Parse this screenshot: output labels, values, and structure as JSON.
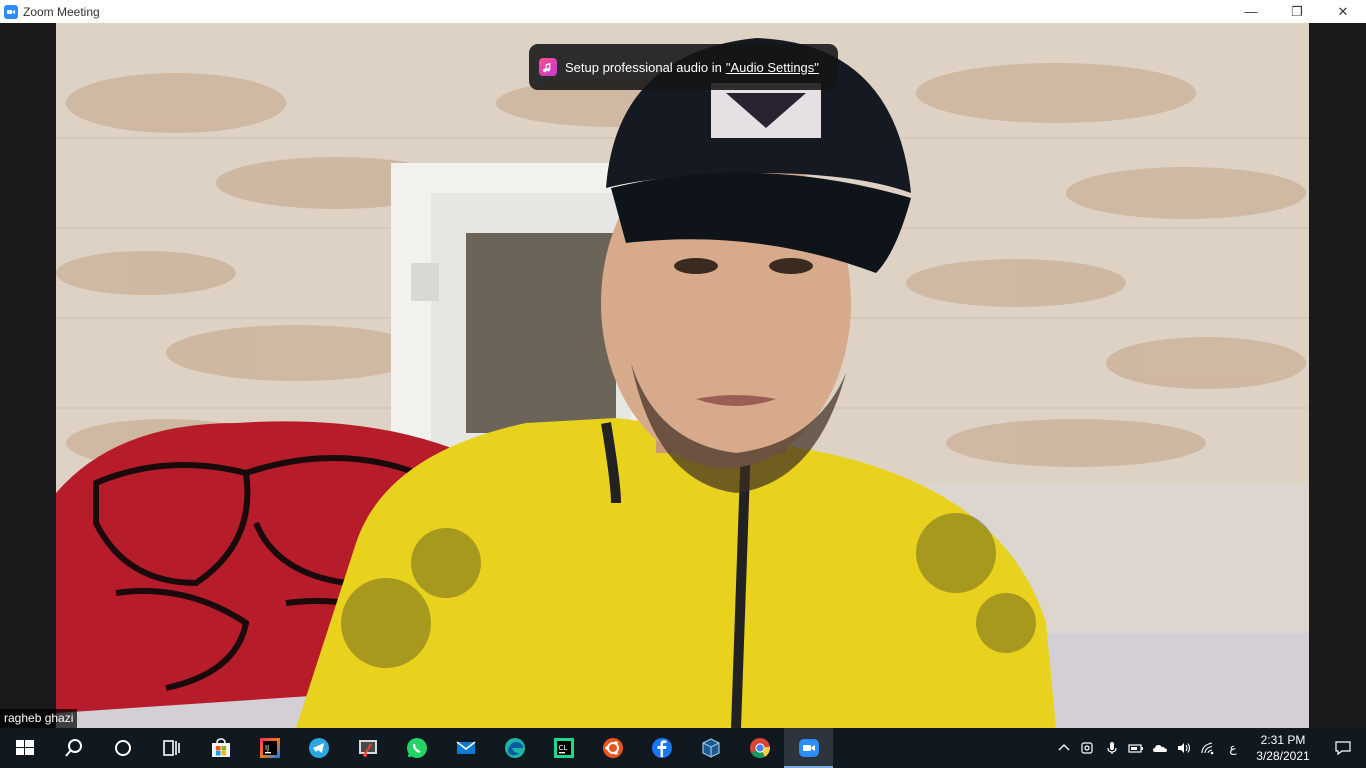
{
  "window": {
    "title": "Zoom Meeting",
    "minimize_glyph": "—",
    "restore_glyph": "❐",
    "close_glyph": "✕"
  },
  "toast": {
    "text": "Setup professional audio in",
    "link": "\"Audio Settings\""
  },
  "participant": {
    "name": "ragheb ghazi"
  },
  "taskbar": {
    "items": [
      {
        "name": "start",
        "icon": "windows-logo-icon"
      },
      {
        "name": "search",
        "icon": "search-icon"
      },
      {
        "name": "cortana",
        "icon": "circle-icon"
      },
      {
        "name": "task-view",
        "icon": "task-view-icon"
      },
      {
        "name": "microsoft-store",
        "icon": "store-icon"
      },
      {
        "name": "intellij-idea",
        "icon": "intellij-icon"
      },
      {
        "name": "telegram",
        "icon": "telegram-icon"
      },
      {
        "name": "snipping-tool",
        "icon": "snip-icon"
      },
      {
        "name": "whatsapp",
        "icon": "whatsapp-icon"
      },
      {
        "name": "mail",
        "icon": "mail-icon"
      },
      {
        "name": "edge",
        "icon": "edge-icon"
      },
      {
        "name": "clion",
        "icon": "clion-icon"
      },
      {
        "name": "ubuntu",
        "icon": "ubuntu-icon"
      },
      {
        "name": "facebook",
        "icon": "facebook-icon"
      },
      {
        "name": "virtualbox",
        "icon": "virtualbox-icon"
      },
      {
        "name": "chrome",
        "icon": "chrome-icon"
      },
      {
        "name": "zoom",
        "icon": "zoom-icon",
        "active": true
      }
    ],
    "tray": {
      "language": "ع",
      "time": "2:31 PM",
      "date": "3/28/2021"
    }
  },
  "colors": {
    "zoom_blue": "#2d8cff",
    "taskbar_bg": "#101820",
    "jersey_yellow": "#e8d21e"
  }
}
